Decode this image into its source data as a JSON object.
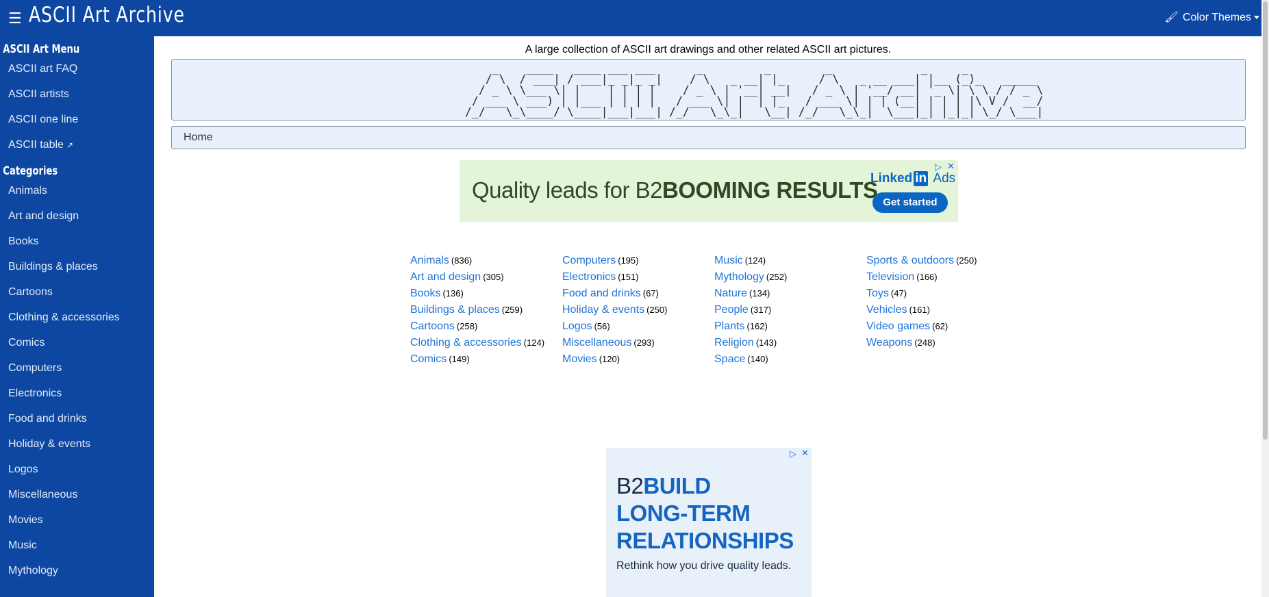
{
  "header": {
    "brand": "ASCII Art Archive",
    "menu_icon": "hamburger-icon",
    "themes_label": "Color Themes",
    "themes_icon": "paintbrush-icon"
  },
  "sidebar": {
    "menu_heading": "ASCII Art Menu",
    "menu_items": [
      "ASCII art FAQ",
      "ASCII artists",
      "ASCII one line",
      "ASCII table"
    ],
    "categories_heading": "Categories",
    "category_items": [
      "Animals",
      "Art and design",
      "Books",
      "Buildings & places",
      "Cartoons",
      "Clothing & accessories",
      "Comics",
      "Computers",
      "Electronics",
      "Food and drinks",
      "Holiday & events",
      "Logos",
      "Miscellaneous",
      "Movies",
      "Music",
      "Mythology"
    ]
  },
  "main": {
    "tagline": "A large collection of ASCII art drawings and other related ASCII art pictures.",
    "breadcrumb": "Home"
  },
  "ad_top": {
    "headline_pre": "Quality leads for B2",
    "headline_bold": "BOOMING RESULTS",
    "brand_linked": "Linked",
    "brand_in": "in",
    "brand_ads": "Ads",
    "cta": "Get started"
  },
  "ad_bottom": {
    "line1_thin": "B2",
    "line1_bold": "BUILD",
    "line2": "LONG-TERM",
    "line3": "RELATIONSHIPS",
    "sub": "Rethink how you drive quality leads."
  },
  "categories": [
    [
      [
        "Animals",
        "(836)"
      ],
      [
        "Art and design",
        "(305)"
      ],
      [
        "Books",
        "(136)"
      ],
      [
        "Buildings & places",
        "(259)"
      ],
      [
        "Cartoons",
        "(258)"
      ],
      [
        "Clothing & accessories",
        "(124)"
      ],
      [
        "Comics",
        "(149)"
      ]
    ],
    [
      [
        "Computers",
        "(195)"
      ],
      [
        "Electronics",
        "(151)"
      ],
      [
        "Food and drinks",
        "(67)"
      ],
      [
        "Holiday & events",
        "(250)"
      ],
      [
        "Logos",
        "(56)"
      ],
      [
        "Miscellaneous",
        "(293)"
      ],
      [
        "Movies",
        "(120)"
      ]
    ],
    [
      [
        "Music",
        "(124)"
      ],
      [
        "Mythology",
        "(252)"
      ],
      [
        "Nature",
        "(134)"
      ],
      [
        "People",
        "(317)"
      ],
      [
        "Plants",
        "(162)"
      ],
      [
        "Religion",
        "(143)"
      ],
      [
        "Space",
        "(140)"
      ]
    ],
    [
      [
        "Sports & outdoors",
        "(250)"
      ],
      [
        "Television",
        "(166)"
      ],
      [
        "Toys",
        "(47)"
      ],
      [
        "Vehicles",
        "(161)"
      ],
      [
        "Video games",
        "(62)"
      ],
      [
        "Weapons",
        "(248)"
      ]
    ]
  ]
}
